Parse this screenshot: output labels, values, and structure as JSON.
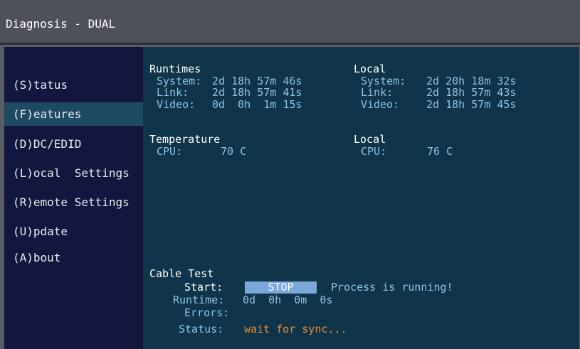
{
  "window": {
    "title": "Diagnosis - DUAL"
  },
  "sidebar": {
    "items": [
      {
        "label": "(S)tatus"
      },
      {
        "label": "(F)eatures"
      },
      {
        "label": "(D)DC/EDID"
      },
      {
        "label": "(L)ocal  Settings"
      },
      {
        "label": "(R)emote Settings"
      },
      {
        "label": "(U)pdate"
      },
      {
        "label": "(A)bout"
      }
    ],
    "active_index": 1
  },
  "runtimes": {
    "heading": "Runtimes",
    "system_label": "System:",
    "system_value": "2d 18h 57m 46s",
    "link_label": "Link:",
    "link_value": "2d 18h 57m 41s",
    "video_label": "Video:",
    "video_value": "0d  0h  1m 15s"
  },
  "local_runtimes": {
    "heading": "Local",
    "system_label": "System:",
    "system_value": "2d 20h 18m 32s",
    "link_label": "Link:",
    "link_value": "2d 18h 57m 43s",
    "video_label": "Video:",
    "video_value": "2d 18h 57m 45s"
  },
  "temperature": {
    "heading": "Temperature",
    "cpu_label": "CPU:",
    "cpu_value": "70 C"
  },
  "local_temperature": {
    "heading": "Local",
    "cpu_label": "CPU:",
    "cpu_value": "76 C"
  },
  "cable_test": {
    "heading": "Cable Test",
    "start_label": "Start:",
    "stop_button": "STOP",
    "process_status": "Process is running!",
    "runtime_label": "Runtime:",
    "runtime_value": "0d  0h  0m  0s",
    "errors_label": "Errors:",
    "status_label": "Status:",
    "status_value": "wait for sync..."
  },
  "colors": {
    "title_bg": "#4f515a",
    "sidebar_bg": "#13173f",
    "active_item": "#1f4a63",
    "content_bg": "#103449",
    "label_blue": "#8cc3e3",
    "status_orange": "#e48b3a",
    "button_blue": "#7aa8d8"
  }
}
